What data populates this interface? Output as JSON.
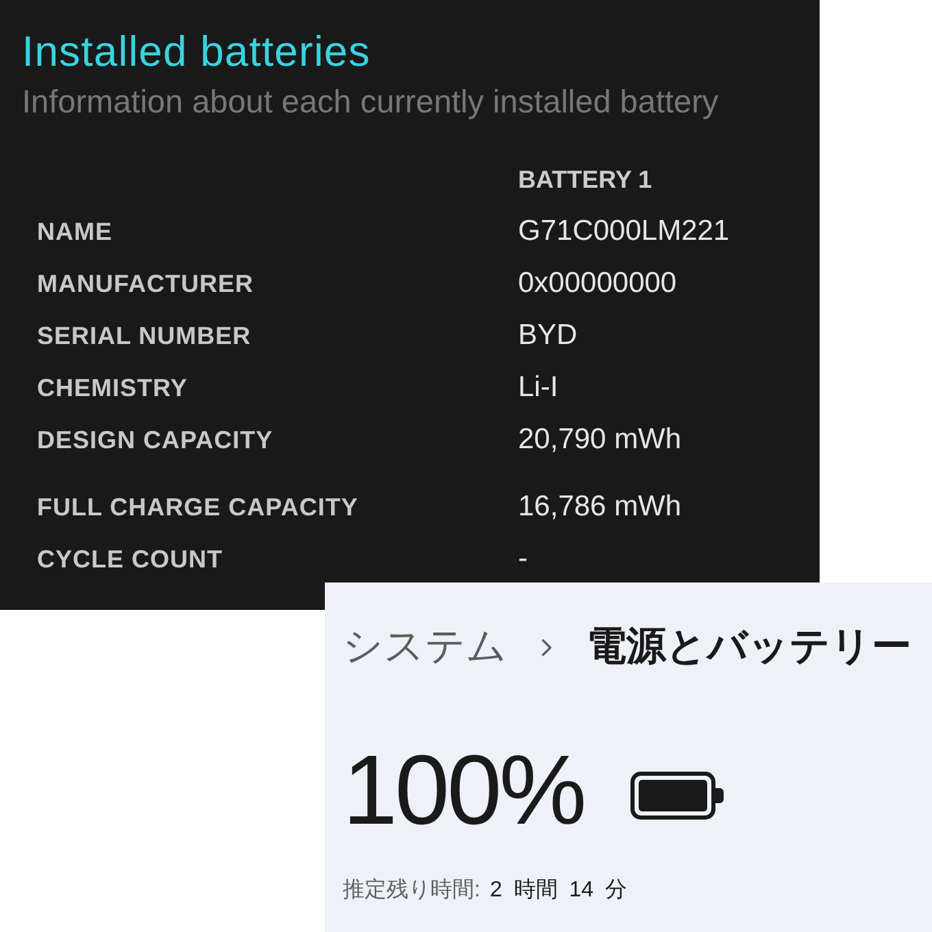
{
  "report": {
    "title": "Installed batteries",
    "subtitle": "Information about each currently installed battery",
    "columns": [
      "BATTERY 1"
    ],
    "sections": [
      {
        "rows": [
          {
            "label": "NAME",
            "value": "G71C000LM221"
          },
          {
            "label": "MANUFACTURER",
            "value": "0x00000000"
          },
          {
            "label": "SERIAL NUMBER",
            "value": "BYD"
          },
          {
            "label": "CHEMISTRY",
            "value": "Li-I"
          },
          {
            "label": "DESIGN CAPACITY",
            "value": "20,790 mWh"
          }
        ]
      },
      {
        "rows": [
          {
            "label": "FULL CHARGE CAPACITY",
            "value": "16,786 mWh"
          },
          {
            "label": "CYCLE COUNT",
            "value": "-"
          }
        ]
      }
    ]
  },
  "settings": {
    "breadcrumb": [
      {
        "label": "システム",
        "current": false
      },
      {
        "label": "電源とバッテリー",
        "current": true
      }
    ],
    "battery": {
      "percent": "100%",
      "estimate_label": "推定残り時間:",
      "estimate_value": "2 時間 14 分"
    }
  }
}
